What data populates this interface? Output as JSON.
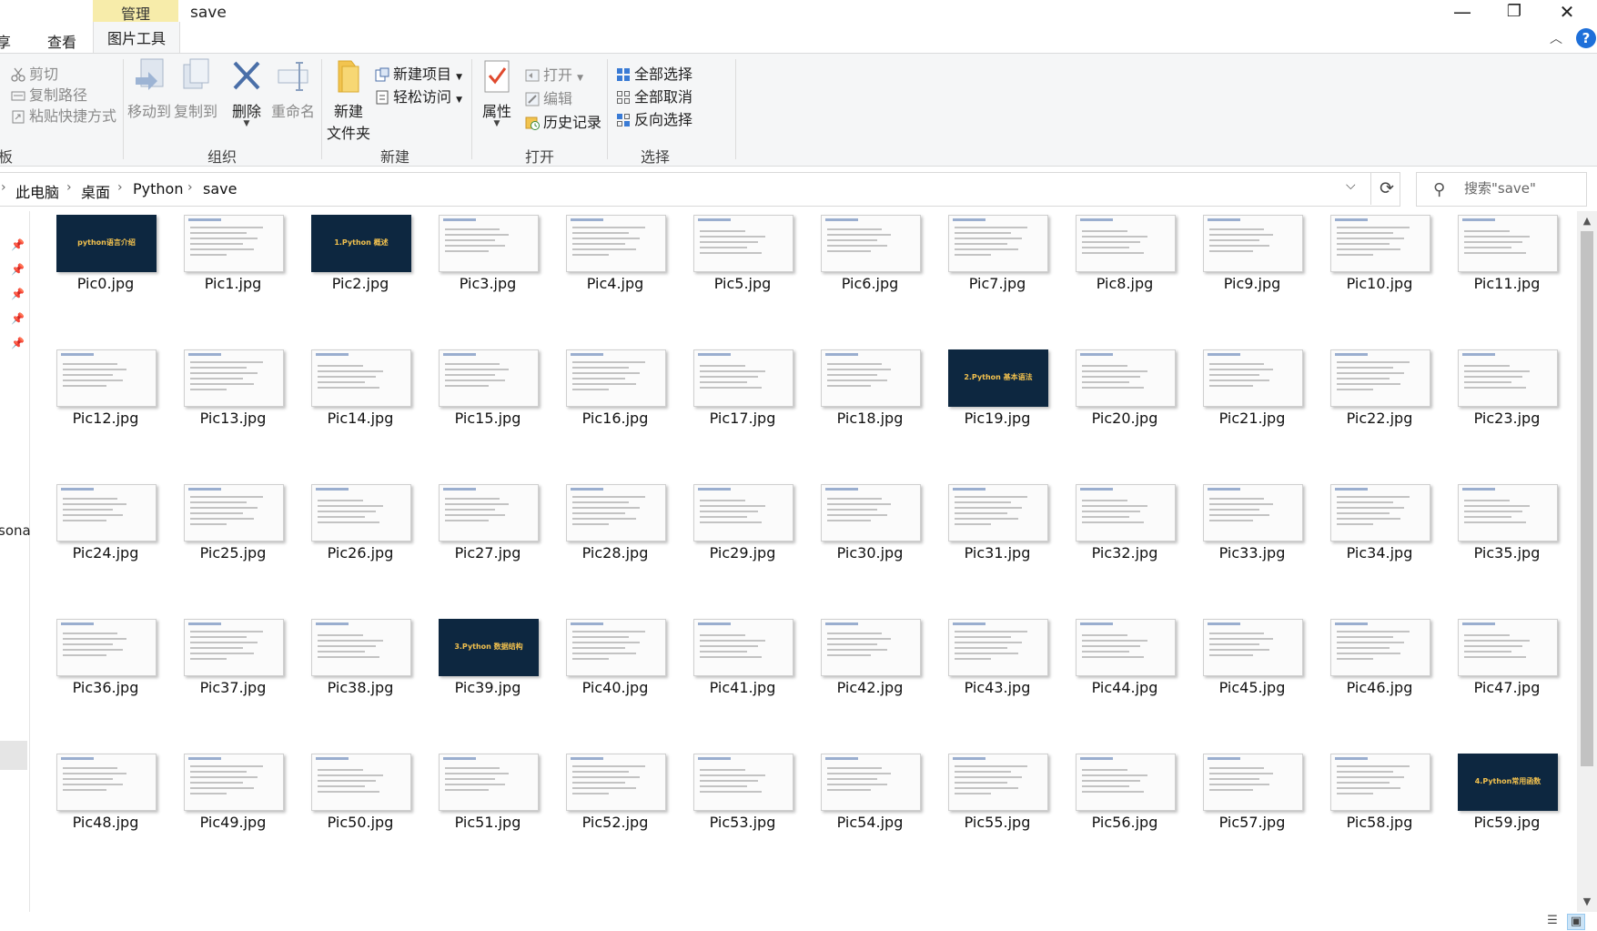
{
  "titlebar": {
    "window_title": "save",
    "tab_manage": "管理",
    "tab_share": "享",
    "tab_view": "查看",
    "tab_picture_tools": "图片工具",
    "minimize_glyph": "—",
    "maximize_glyph": "❐",
    "close_glyph": "✕",
    "collapse_glyph": "︿",
    "help_glyph": "?"
  },
  "ribbon": {
    "clipboard": {
      "cut": "剪切",
      "copy_path": "复制路径",
      "paste_shortcut": "粘贴快捷方式",
      "group_label": "板"
    },
    "organize": {
      "move_to": "移动到",
      "copy_to": "复制到",
      "delete": "删除",
      "rename": "重命名",
      "group_label": "组织"
    },
    "new": {
      "new_folder_line1": "新建",
      "new_folder_line2": "文件夹",
      "new_item": "新建项目",
      "easy_access": "轻松访问",
      "group_label": "新建"
    },
    "open": {
      "properties": "属性",
      "open": "打开",
      "edit": "编辑",
      "history": "历史记录",
      "group_label": "打开"
    },
    "select": {
      "select_all": "全部选择",
      "select_none": "全部取消",
      "invert": "反向选择",
      "group_label": "选择"
    }
  },
  "address": {
    "crumbs": [
      "此电脑",
      "桌面",
      "Python",
      "save"
    ],
    "search_placeholder": "搜索\"save\""
  },
  "navpane": {
    "partial_label": "sona"
  },
  "files": [
    "Pic0.jpg",
    "Pic1.jpg",
    "Pic2.jpg",
    "Pic3.jpg",
    "Pic4.jpg",
    "Pic5.jpg",
    "Pic6.jpg",
    "Pic7.jpg",
    "Pic8.jpg",
    "Pic9.jpg",
    "Pic10.jpg",
    "Pic11.jpg",
    "Pic12.jpg",
    "Pic13.jpg",
    "Pic14.jpg",
    "Pic15.jpg",
    "Pic16.jpg",
    "Pic17.jpg",
    "Pic18.jpg",
    "Pic19.jpg",
    "Pic20.jpg",
    "Pic21.jpg",
    "Pic22.jpg",
    "Pic23.jpg",
    "Pic24.jpg",
    "Pic25.jpg",
    "Pic26.jpg",
    "Pic27.jpg",
    "Pic28.jpg",
    "Pic29.jpg",
    "Pic30.jpg",
    "Pic31.jpg",
    "Pic32.jpg",
    "Pic33.jpg",
    "Pic34.jpg",
    "Pic35.jpg",
    "Pic36.jpg",
    "Pic37.jpg",
    "Pic38.jpg",
    "Pic39.jpg",
    "Pic40.jpg",
    "Pic41.jpg",
    "Pic42.jpg",
    "Pic43.jpg",
    "Pic44.jpg",
    "Pic45.jpg",
    "Pic46.jpg",
    "Pic47.jpg",
    "Pic48.jpg",
    "Pic49.jpg",
    "Pic50.jpg",
    "Pic51.jpg",
    "Pic52.jpg",
    "Pic53.jpg",
    "Pic54.jpg",
    "Pic55.jpg",
    "Pic56.jpg",
    "Pic57.jpg",
    "Pic58.jpg",
    "Pic59.jpg"
  ],
  "dark_thumbnails": {
    "Pic0.jpg": "python语言介绍",
    "Pic2.jpg": "1.Python 概述",
    "Pic19.jpg": "2.Python 基本语法",
    "Pic39.jpg": "3.Python 数据结构",
    "Pic59.jpg": "4.Python常用函数"
  },
  "colors": {
    "accent": "#1e6fd9",
    "manage_tab": "#f7ecaa",
    "ribbon_bg": "#f5f6f7",
    "dark_slide": "#0d2740"
  }
}
